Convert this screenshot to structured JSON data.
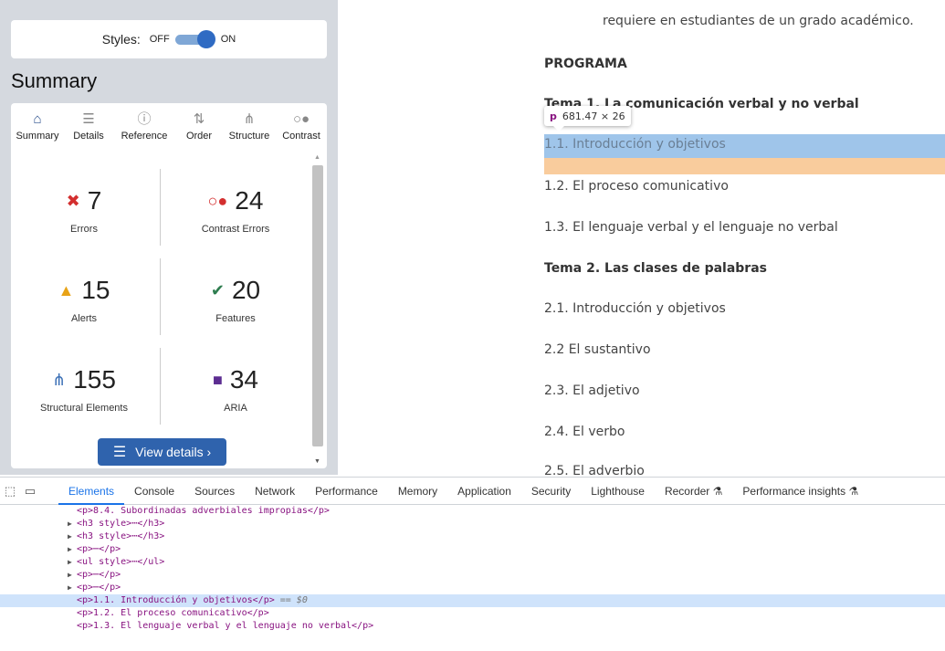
{
  "wave": {
    "styles_label": "Styles:",
    "off_label": "OFF",
    "on_label": "ON",
    "summary_title": "Summary",
    "tabs": [
      {
        "label": "Summary",
        "icon": "home-icon",
        "glyph": "⌂"
      },
      {
        "label": "Details",
        "icon": "list-icon",
        "glyph": "☰"
      },
      {
        "label": "Reference",
        "icon": "info-icon",
        "glyph": "ⓘ"
      },
      {
        "label": "Order",
        "icon": "order-icon",
        "glyph": "⇅"
      },
      {
        "label": "Structure",
        "icon": "structure-icon",
        "glyph": "⋔"
      },
      {
        "label": "Contrast",
        "icon": "contrast-icon",
        "glyph": "○●"
      }
    ],
    "stats": [
      {
        "value": "7",
        "label": "Errors",
        "icon": "error-icon",
        "glyph": "✖",
        "color": "#d32f2f"
      },
      {
        "value": "24",
        "label": "Contrast Errors",
        "icon": "contrast-error-icon",
        "glyph": "○●",
        "color": "#d32f2f"
      },
      {
        "value": "15",
        "label": "Alerts",
        "icon": "alert-icon",
        "glyph": "▲",
        "color": "#e8a317"
      },
      {
        "value": "20",
        "label": "Features",
        "icon": "feature-icon",
        "glyph": "✔",
        "color": "#2e7d4f"
      },
      {
        "value": "155",
        "label": "Structural Elements",
        "icon": "structure-element-icon",
        "glyph": "⋔",
        "color": "#3a6fb5"
      },
      {
        "value": "34",
        "label": "ARIA",
        "icon": "aria-icon",
        "glyph": "■",
        "color": "#5c2d91"
      }
    ],
    "view_details_label": "View details ›"
  },
  "page": {
    "intro_line": "requiere en estudiantes de un grado académico.",
    "programa": "PROGRAMA",
    "tema1": "Tema 1. La comunicación verbal y no verbal",
    "items1": [
      "1.1. Introducción y objetivos",
      "1.2. El proceso comunicativo",
      "1.3. El lenguaje verbal y el lenguaje no verbal"
    ],
    "tema2": "Tema 2. Las clases de palabras",
    "items2": [
      "2.1. Introducción y objetivos",
      "2.2 El sustantivo",
      "2.3. El adjetivo",
      "2.4. El verbo",
      "2.5. El adverbio"
    ],
    "tooltip_tag": "p",
    "tooltip_size": "681.47 × 26",
    "highlight_color": "#9fc5ea",
    "margin_color": "#f9cc9d"
  },
  "devtools": {
    "tabs": [
      "Elements",
      "Console",
      "Sources",
      "Network",
      "Performance",
      "Memory",
      "Application",
      "Security",
      "Lighthouse",
      "Recorder ⚗",
      "Performance insights ⚗"
    ],
    "active_tab": "Elements",
    "dom_lines": [
      {
        "arrow": "",
        "text": "<p>8.4. Subordinadas adverbiales impropias</p>",
        "indent": 1
      },
      {
        "arrow": "▶",
        "text": "<h3 style>⋯</h3>",
        "indent": 0
      },
      {
        "arrow": "▶",
        "text": "<h3 style>⋯</h3>",
        "indent": 0
      },
      {
        "arrow": "▶",
        "text": "<p>⋯</p>",
        "indent": 0
      },
      {
        "arrow": "▶",
        "text": "<ul style>⋯</ul>",
        "indent": 0
      },
      {
        "arrow": "▶",
        "text": "<p>⋯</p>",
        "indent": 0
      },
      {
        "arrow": "▶",
        "text": "<p>⋯</p>",
        "indent": 0
      },
      {
        "arrow": "",
        "text": "<p>1.1. Introducción y objetivos</p>",
        "suffix": " == $0",
        "indent": 1,
        "selected": true
      },
      {
        "arrow": "",
        "text": "<p>1.2. El proceso comunicativo</p>",
        "indent": 1
      },
      {
        "arrow": "",
        "text": "<p>1.3. El lenguaje verbal y el lenguaje no verbal</p>",
        "indent": 1
      }
    ]
  }
}
